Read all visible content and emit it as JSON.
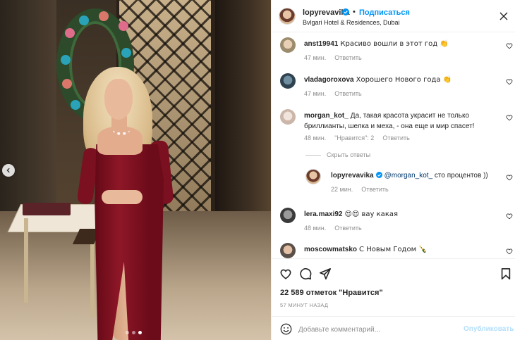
{
  "post": {
    "author": "lopyrevavika",
    "separator": "•",
    "follow_label": "Подписаться",
    "location": "Bvlgari Hotel & Residences, Dubai",
    "carousel": {
      "slides": 3,
      "active_index": 2
    }
  },
  "comments": [
    {
      "user": "anst19941",
      "text": "Красиво вошли в этот год 👏",
      "time": "47 мин.",
      "reply_label": "Ответить"
    },
    {
      "user": "vladagoroxova",
      "text": "Хорошего Нового года 👏",
      "time": "47 мин.",
      "reply_label": "Ответить"
    },
    {
      "user": "morgan_kot_",
      "text": "Да, такая красота украсит не только бриллианты, шелка и меха, - она еще и мир спасет!",
      "time": "48 мин.",
      "likes": "\"Нравится\": 2",
      "reply_label": "Ответить"
    },
    {
      "user": "lopyrevavika",
      "mention": "@morgan_kot_",
      "text": " сто процентов ))",
      "time": "22 мин.",
      "reply_label": "Ответить"
    },
    {
      "user": "lera.maxi92",
      "text": "😍😍 вау какая",
      "time": "48 мин.",
      "reply_label": "Ответить"
    },
    {
      "user": "moscowmatsko",
      "text": "С Новым Годом 🍾",
      "time": "",
      "reply_label": ""
    }
  ],
  "hide_replies_label": "Скрыть ответы",
  "likes_text": "22 589 отметок \"Нравится\"",
  "posted_time": "57 минут назад",
  "composer": {
    "placeholder": "Добавьте комментарий...",
    "publish_label": "Опубликовать"
  },
  "colors": {
    "accent": "#0095f6",
    "publish_disabled": "#b2dffc",
    "muted_text": "#8e8e8e",
    "dress": "#8e1727"
  },
  "icons": [
    "chevron-left-icon",
    "verified-badge-icon",
    "more-options-icon",
    "heart-icon",
    "comment-icon",
    "share-icon",
    "bookmark-icon",
    "emoji-icon"
  ]
}
